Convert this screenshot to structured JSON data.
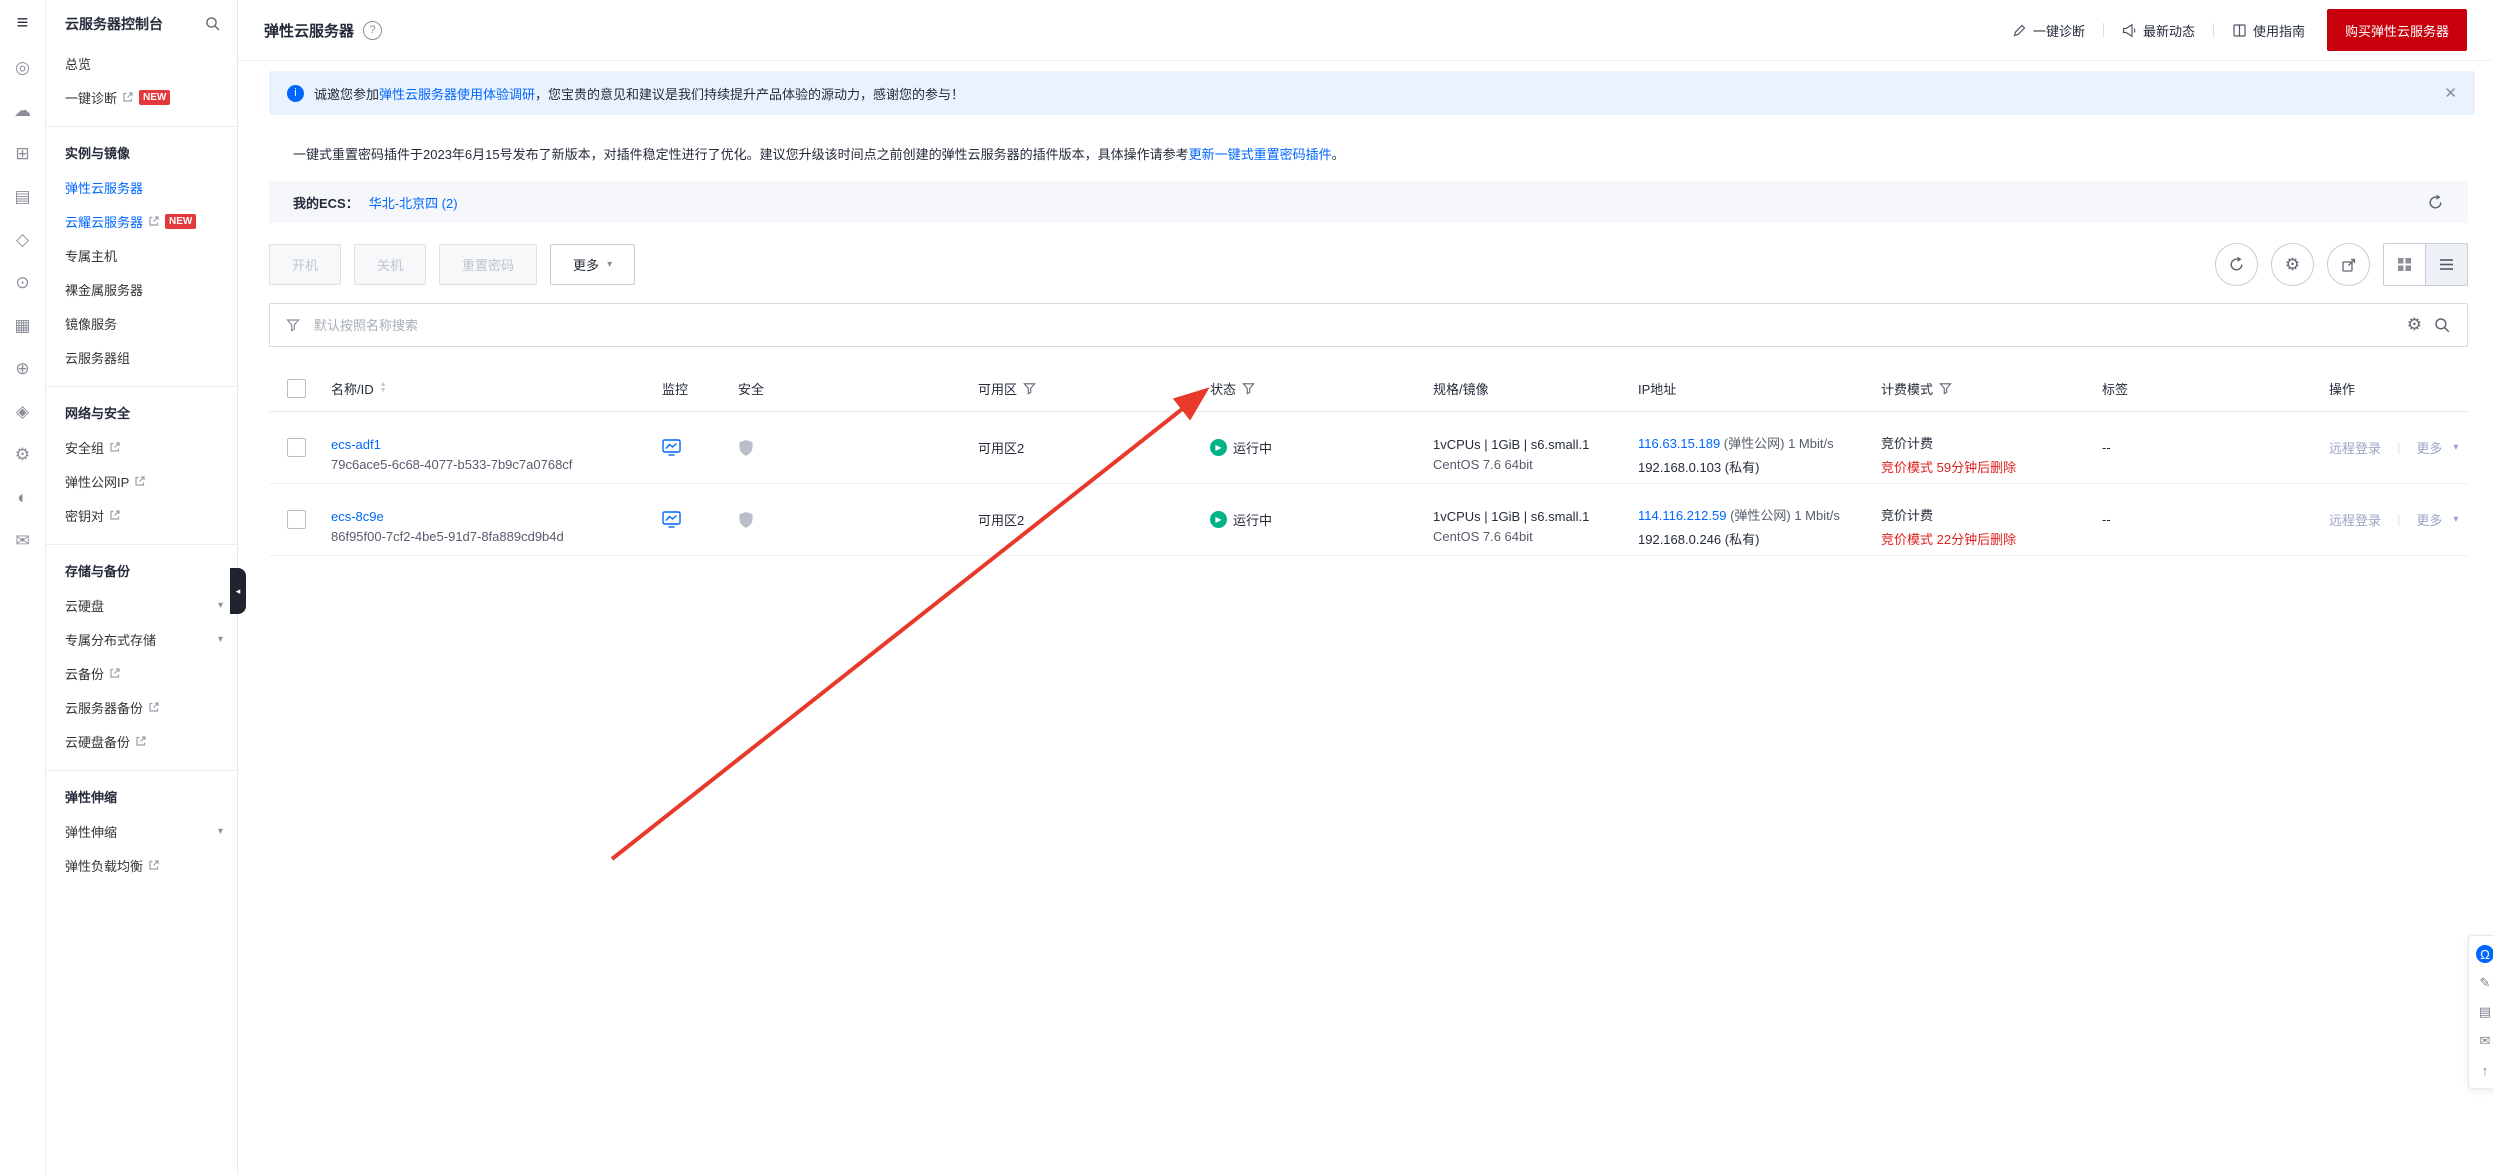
{
  "colors": {
    "brand_red": "#c7000b",
    "link_blue": "#0066fe",
    "status_green": "#00b386",
    "badge_red": "#e4393c",
    "danger_red": "#e02020",
    "banner_bg": "#e9f2fd",
    "arrow_red": "#e8392b"
  },
  "icon_rail": {
    "icons": [
      "menu",
      "overview",
      "cloud-services",
      "compute",
      "documents",
      "database",
      "network",
      "storage",
      "security",
      "management",
      "settings",
      "developer",
      "messages"
    ]
  },
  "sidebar": {
    "title": "云服务器控制台",
    "items_top": [
      {
        "label": "总览"
      },
      {
        "label": "一键诊断",
        "badge": "NEW"
      }
    ],
    "sections": [
      {
        "header": "实例与镜像",
        "items": [
          {
            "label": "弹性云服务器"
          },
          {
            "label": "云耀云服务器",
            "badge": "NEW"
          },
          {
            "label": "专属主机"
          },
          {
            "label": "裸金属服务器"
          },
          {
            "label": "镜像服务"
          },
          {
            "label": "云服务器组"
          }
        ]
      },
      {
        "header": "网络与安全",
        "items": [
          {
            "label": "安全组"
          },
          {
            "label": "弹性公网IP"
          },
          {
            "label": "密钥对"
          }
        ]
      },
      {
        "header": "存储与备份",
        "items": [
          {
            "label": "云硬盘"
          },
          {
            "label": "专属分布式存储"
          },
          {
            "label": "云备份"
          },
          {
            "label": "云服务器备份"
          },
          {
            "label": "云硬盘备份"
          }
        ]
      },
      {
        "header": "弹性伸缩",
        "items": [
          {
            "label": "弹性伸缩"
          },
          {
            "label": "弹性负载均衡"
          }
        ]
      }
    ]
  },
  "header": {
    "title": "弹性云服务器",
    "actions": [
      {
        "label": "一键诊断"
      },
      {
        "label": "最新动态"
      },
      {
        "label": "使用指南"
      }
    ],
    "buy_button": "购买弹性云服务器"
  },
  "banner": {
    "prefix": "诚邀您参加",
    "link": "弹性云服务器使用体验调研",
    "suffix": "，您宝贵的意见和建议是我们持续提升产品体验的源动力，感谢您的参与！"
  },
  "notice": {
    "text": "一键式重置密码插件于2023年6月15号发布了新版本，对插件稳定性进行了优化。建议您升级该时间点之前创建的弹性云服务器的插件版本，具体操作请参考",
    "link": "更新一键式重置密码插件",
    "suffix": "。"
  },
  "my_ecs": {
    "label": "我的ECS：",
    "region": "华北-北京四 (2)"
  },
  "toolbar": {
    "power_on": "开机",
    "power_off": "关机",
    "reset_password": "重置密码",
    "more": "更多"
  },
  "search": {
    "placeholder": "默认按照名称搜索"
  },
  "table": {
    "columns": [
      "名称/ID",
      "监控",
      "安全",
      "可用区",
      "状态",
      "规格/镜像",
      "IP地址",
      "计费模式",
      "标签",
      "操作"
    ],
    "rows": [
      {
        "name": "ecs-adf1",
        "id": "79c6ace5-6c68-4077-b533-7b9c7a0768cf",
        "az": "可用区2",
        "status": "运行中",
        "spec": "1vCPUs | 1GiB | s6.small.1",
        "image": "CentOS 7.6 64bit",
        "eip": "116.63.15.189",
        "eip_note": "(弹性公网) 1 Mbit/s",
        "private_ip": "192.168.0.103 (私有)",
        "billing": "竞价计费",
        "billing_note": "竞价模式 59分钟后删除",
        "tags": "--",
        "op_remote": "远程登录",
        "op_more": "更多"
      },
      {
        "name": "ecs-8c9e",
        "id": "86f95f00-7cf2-4be5-91d7-8fa889cd9b4d",
        "az": "可用区2",
        "status": "运行中",
        "spec": "1vCPUs | 1GiB | s6.small.1",
        "image": "CentOS 7.6 64bit",
        "eip": "114.116.212.59",
        "eip_note": "(弹性公网) 1 Mbit/s",
        "private_ip": "192.168.0.246 (私有)",
        "billing": "竞价计费",
        "billing_note": "竞价模式 22分钟后删除",
        "tags": "--",
        "op_remote": "远程登录",
        "op_more": "更多"
      }
    ]
  }
}
